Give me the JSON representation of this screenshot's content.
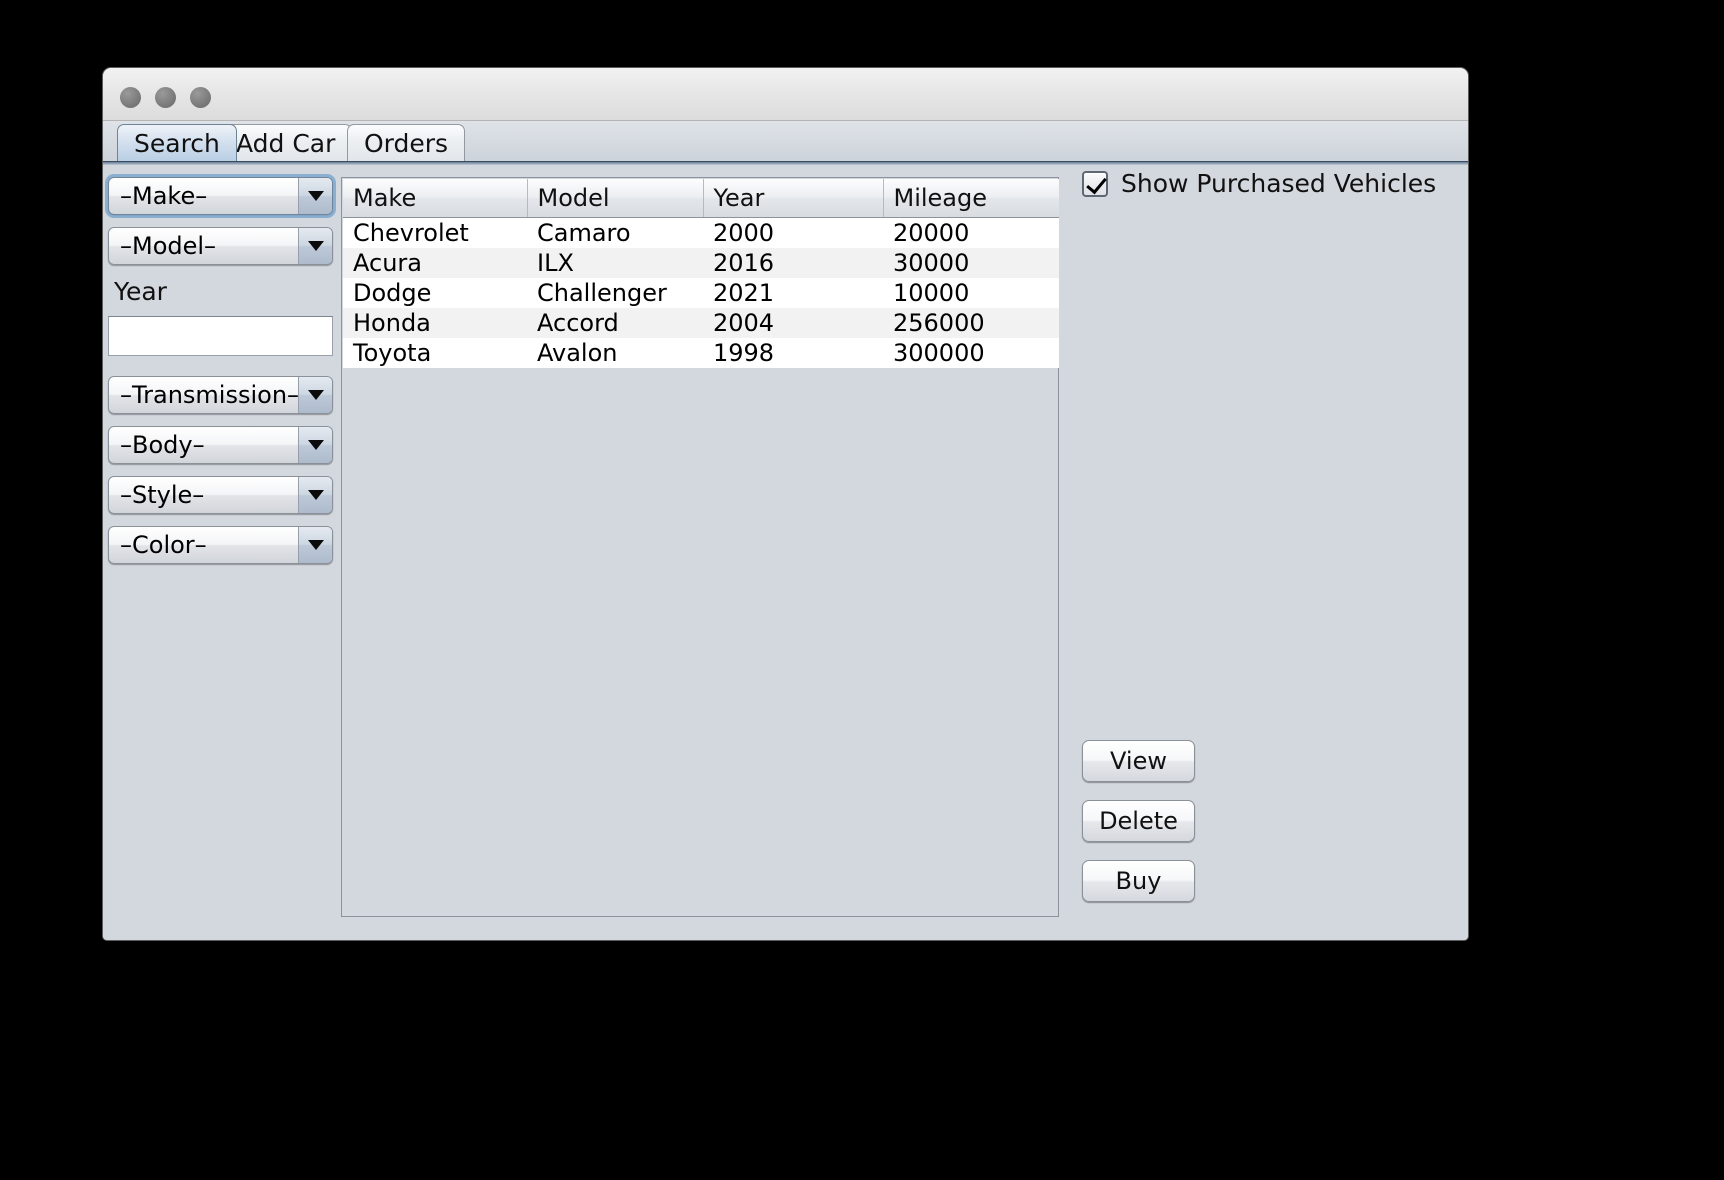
{
  "window": {
    "traffic_lights": [
      "close-button",
      "minimize-button",
      "zoom-button"
    ]
  },
  "tabs": [
    {
      "label": "Search",
      "active": true
    },
    {
      "label": "Add Car",
      "active": false
    },
    {
      "label": "Orders",
      "active": false
    }
  ],
  "filters": {
    "make": {
      "value": "–Make–",
      "focused": true
    },
    "model": {
      "value": "–Model–",
      "focused": false
    },
    "year_label": "Year",
    "year_value": "",
    "year_placeholder": "",
    "transmission": {
      "value": "–Transmission–",
      "focused": false
    },
    "body": {
      "value": "–Body–",
      "focused": false
    },
    "style": {
      "value": "–Style–",
      "focused": false
    },
    "color": {
      "value": "–Color–",
      "focused": false
    }
  },
  "table": {
    "columns": [
      "Make",
      "Model",
      "Year",
      "Mileage"
    ],
    "rows": [
      [
        "Chevrolet",
        "Camaro",
        "2000",
        "20000"
      ],
      [
        "Acura",
        "ILX",
        "2016",
        "30000"
      ],
      [
        "Dodge",
        "Challenger",
        "2021",
        "10000"
      ],
      [
        "Honda",
        "Accord",
        "2004",
        "256000"
      ],
      [
        "Toyota",
        "Avalon",
        "1998",
        "300000"
      ]
    ]
  },
  "right_panel": {
    "show_purchased": {
      "label": "Show Purchased Vehicles",
      "checked": true
    },
    "buttons": [
      {
        "label": "View"
      },
      {
        "label": "Delete"
      },
      {
        "label": "Buy"
      }
    ]
  },
  "colors": {
    "window_bg": "#d3d7de",
    "titlebar": "#e9e9e9",
    "active_tab": "#b9cfe4",
    "table_row_alt": "#f2f2f2",
    "focus_ring": "#7da8ce"
  }
}
